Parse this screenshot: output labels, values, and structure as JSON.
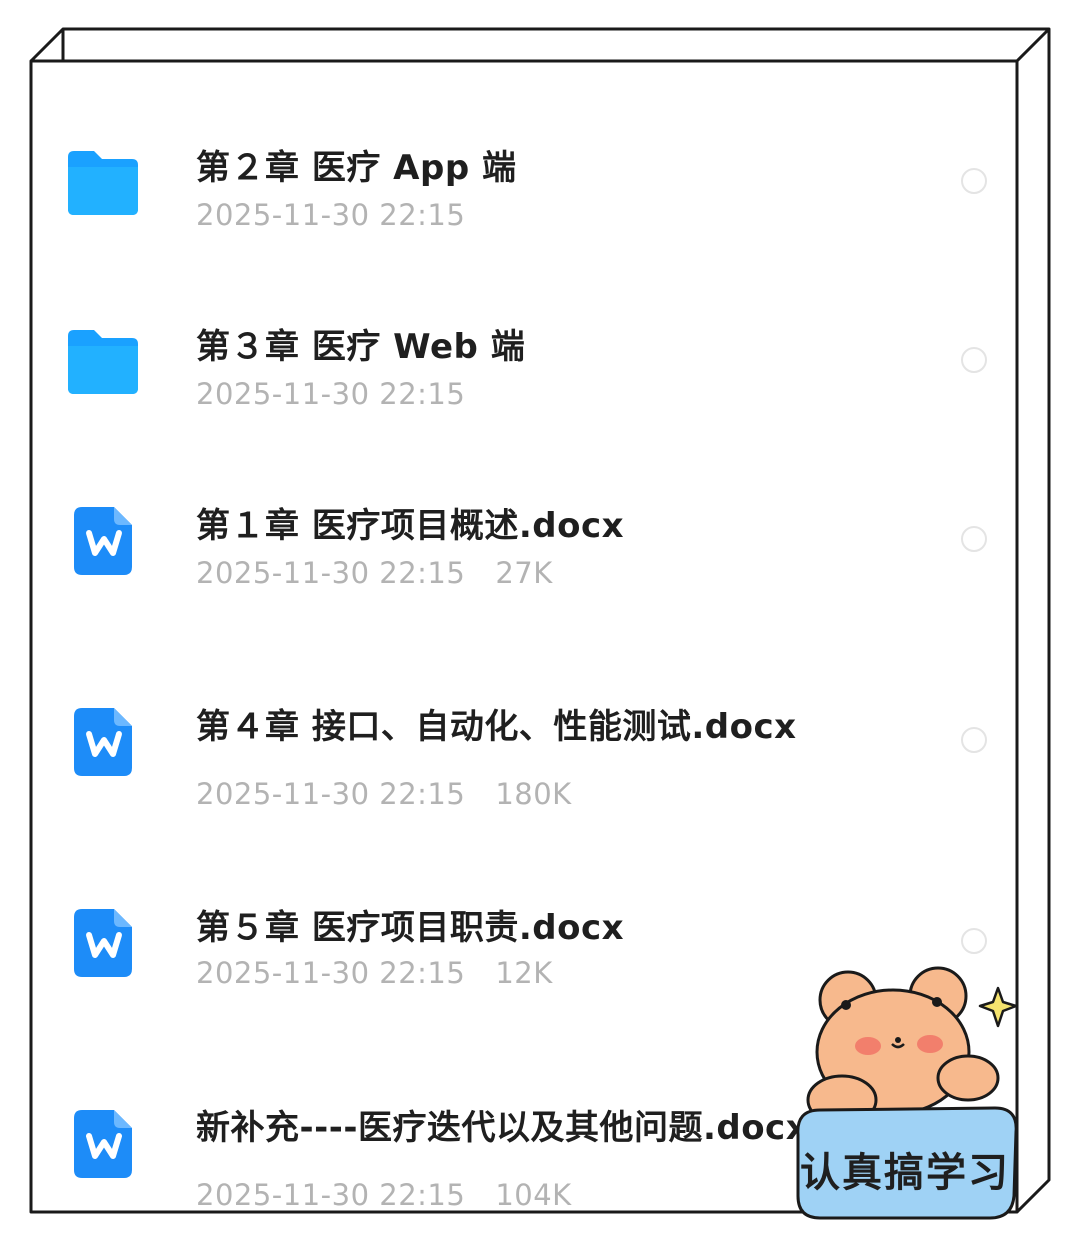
{
  "files": [
    {
      "type": "folder",
      "icon": "folder-icon",
      "name": "第２章 医疗 App 端",
      "date": "2025-11-30 22:15",
      "size": ""
    },
    {
      "type": "folder",
      "icon": "folder-icon",
      "name": "第３章 医疗 Web 端",
      "date": "2025-11-30 22:15",
      "size": ""
    },
    {
      "type": "docx",
      "icon": "word-doc-icon",
      "name": "第１章 医疗项目概述.docx",
      "date": "2025-11-30 22:15",
      "size": "27K"
    },
    {
      "type": "docx",
      "icon": "word-doc-icon",
      "name": "第４章 接口、自动化、性能测试.docx",
      "date": "2025-11-30 22:15",
      "size": "180K"
    },
    {
      "type": "docx",
      "icon": "word-doc-icon",
      "name": "第５章  医疗项目职责.docx",
      "date": "2025-11-30 22:15",
      "size": "12K"
    },
    {
      "type": "docx",
      "icon": "word-doc-icon",
      "name": "新补充----医疗迭代以及其他问题.docx",
      "date": "2025-11-30 22:15",
      "size": "104K"
    }
  ],
  "sticker": {
    "label": "认真搞学习",
    "icon": "bear-sticker-icon"
  },
  "colors": {
    "folder": "#1fa0ff",
    "word": "#1d8cf8",
    "meta": "#b3b3b3",
    "name": "#1f1f1f"
  }
}
